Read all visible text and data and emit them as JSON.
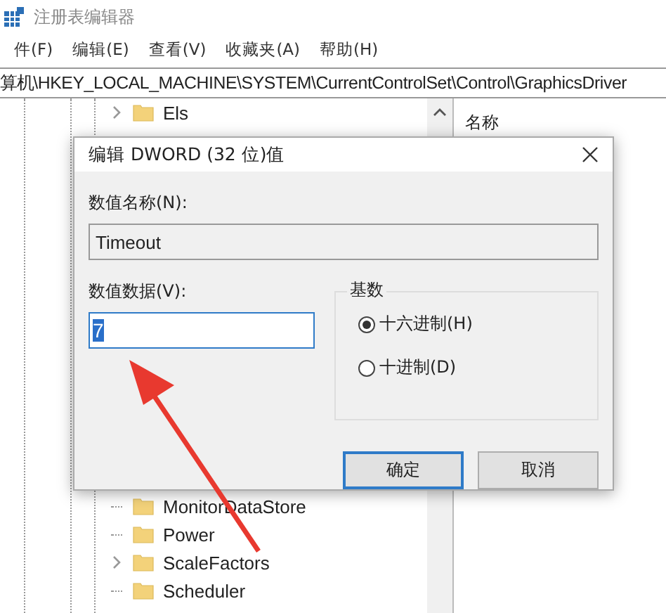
{
  "window": {
    "title": "注册表编辑器"
  },
  "menu": [
    "件(F)",
    "编辑(E)",
    "查看(V)",
    "收藏夹(A)",
    "帮助(H)"
  ],
  "address": "算机\\HKEY_LOCAL_MACHINE\\SYSTEM\\CurrentControlSet\\Control\\GraphicsDriver",
  "tree": {
    "above": [
      {
        "label": "Els",
        "expandable": true
      }
    ],
    "below": [
      {
        "label": "MonitorDataStore",
        "expandable": false
      },
      {
        "label": "Power",
        "expandable": false
      },
      {
        "label": "ScaleFactors",
        "expandable": true
      },
      {
        "label": "Scheduler",
        "expandable": false
      }
    ]
  },
  "list_header": "名称",
  "dialog": {
    "title": "编辑 DWORD (32 位)值",
    "name_label": "数值名称(N):",
    "name_value": "Timeout",
    "data_label": "数值数据(V):",
    "data_value": "7",
    "data_value_selected": true,
    "base_label": "基数",
    "bases": [
      {
        "label": "十六进制(H)",
        "selected": true
      },
      {
        "label": "十进制(D)",
        "selected": false
      }
    ],
    "buttons": [
      {
        "label": "确定",
        "default": true
      },
      {
        "label": "取消",
        "default": false
      }
    ]
  }
}
